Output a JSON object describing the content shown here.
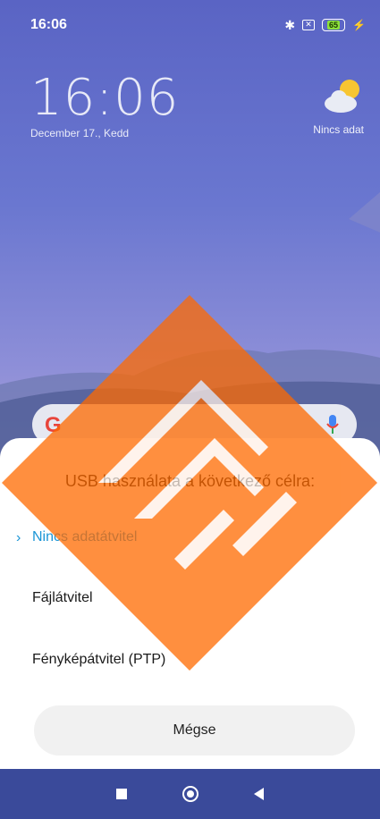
{
  "status_bar": {
    "time": "16:06",
    "battery": "65",
    "icons": [
      "bluetooth-icon",
      "sim-icon",
      "battery-icon",
      "charging-icon"
    ]
  },
  "lockscreen": {
    "clock_time": "16:06",
    "clock_date": "December 17., Kedd",
    "weather_text": "Nincs adat"
  },
  "dialog": {
    "title": "USB használata a következő célra:",
    "options": [
      {
        "label": "Nincs adatátvitel",
        "selected": true
      },
      {
        "label": "Fájlátvitel",
        "selected": false
      },
      {
        "label": "Fényképátvitel (PTP)",
        "selected": false
      }
    ],
    "cancel_label": "Mégse"
  },
  "colors": {
    "accent": "#1a95d6",
    "watermark": "#ff6a00"
  }
}
